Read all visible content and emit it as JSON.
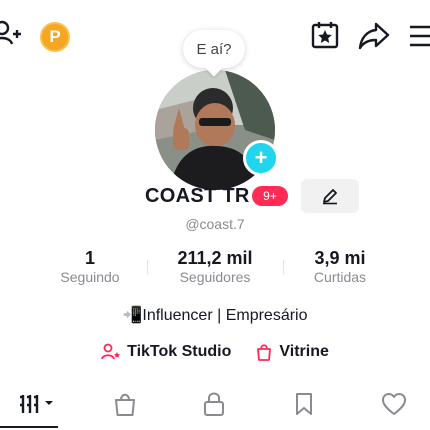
{
  "header": {
    "add_user_icon": "add-user-icon",
    "points_label": "P",
    "points_color": "#F5A623",
    "calendar_icon": "calendar-star-icon",
    "share_icon": "share-icon",
    "menu_icon": "menu-icon"
  },
  "profile": {
    "bubble_text": "E aí?",
    "name": "COAST TR",
    "notification_count": "9+",
    "handle": "@coast.7",
    "edit_icon": "pencil-icon",
    "avatar_plus": "+"
  },
  "stats": [
    {
      "value": "1",
      "label": "Seguindo"
    },
    {
      "value": "211,2 mil",
      "label": "Seguidores"
    },
    {
      "value": "3,9 mi",
      "label": "Curtidas"
    }
  ],
  "bio": "📲Influencer | Empresário",
  "links": {
    "studio_label": "TikTok Studio",
    "vitrine_label": "Vitrine"
  },
  "tabs": [
    {
      "icon": "grid-icon"
    },
    {
      "icon": "shopping-bag-icon"
    },
    {
      "icon": "lock-icon"
    },
    {
      "icon": "bookmark-icon"
    },
    {
      "icon": "heart-icon"
    }
  ],
  "colors": {
    "accent_red": "#FE2C55",
    "accent_cyan": "#20D5EC"
  }
}
